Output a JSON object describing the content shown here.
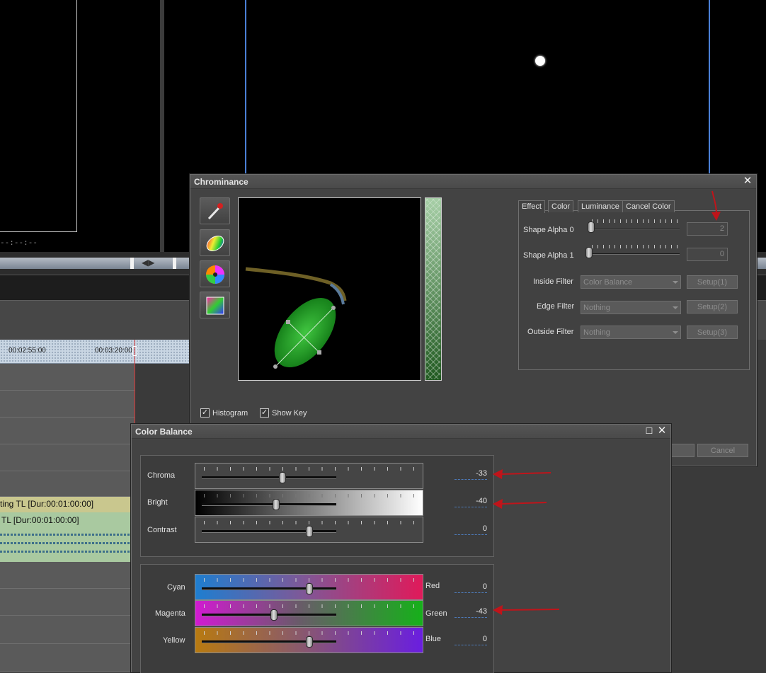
{
  "viewer": {
    "timecode": "--:--:--"
  },
  "timeline": {
    "ruler_ticks": [
      "00:02:55:00",
      "00:03:20:00"
    ],
    "video_clip_label": "ting  TL [Dur:00:01:00:00]",
    "audio_clip_label": "TL [Dur:00:01:00:00]"
  },
  "chrominance": {
    "title": "Chrominance",
    "tools": [
      {
        "name": "eyedropper-icon"
      },
      {
        "name": "ellipse-key-icon"
      },
      {
        "name": "color-wheel-icon"
      },
      {
        "name": "rectangle-key-icon"
      }
    ],
    "checkboxes": [
      {
        "label": "Histogram",
        "checked": true
      },
      {
        "label": "Show Key",
        "checked": true
      }
    ],
    "tabs": [
      "Effect",
      "Color",
      "Luminance",
      "Cancel Color"
    ],
    "active_tab": "Effect",
    "shape_alpha_0": {
      "label": "Shape Alpha 0",
      "value": "2"
    },
    "shape_alpha_1": {
      "label": "Shape Alpha 1",
      "value": "0"
    },
    "filters": [
      {
        "label": "Inside Filter",
        "value": "Color Balance",
        "button": "Setup(1)"
      },
      {
        "label": "Edge Filter",
        "value": "Nothing",
        "button": "Setup(2)"
      },
      {
        "label": "Outside Filter",
        "value": "Nothing",
        "button": "Setup(3)"
      }
    ],
    "cancel_label": "Cancel"
  },
  "color_balance": {
    "title": "Color Balance",
    "chroma": {
      "label": "Chroma",
      "value": "-33"
    },
    "bright": {
      "label": "Bright",
      "value": "-40"
    },
    "contrast": {
      "label": "Contrast",
      "value": "0"
    },
    "cyan_red": {
      "left": "Cyan",
      "right": "Red",
      "value": "0"
    },
    "magenta_green": {
      "left": "Magenta",
      "right": "Green",
      "value": "-43"
    },
    "yellow_blue": {
      "left": "Yellow",
      "right": "Blue",
      "value": "0"
    }
  },
  "annotation_color": "#c0141a"
}
